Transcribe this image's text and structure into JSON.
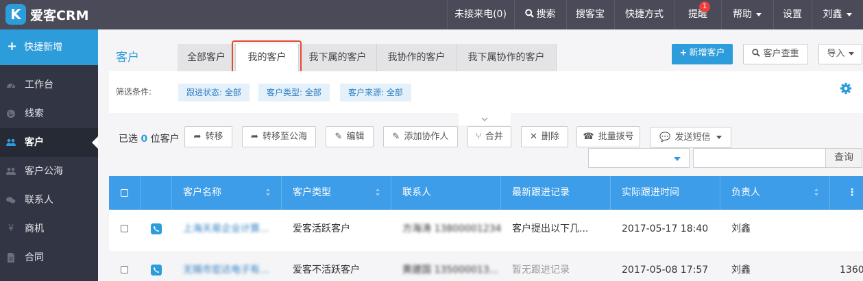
{
  "app": {
    "logo_glyph": "K",
    "name": "爱客CRM",
    "brand_color": "#2d9cdb"
  },
  "topnav": {
    "missed_calls": "未接来电(0)",
    "search": "搜索",
    "search_icon": "search-icon",
    "aike_bao": "搜客宝",
    "shortcuts": "快捷方式",
    "reminders": "提醒",
    "reminders_badge": "1",
    "help": "帮助",
    "settings": "设置",
    "user": "刘鑫"
  },
  "sidebar": {
    "quick_add": "快捷新增",
    "items": [
      {
        "label": "工作台",
        "icon": "dashboard-icon"
      },
      {
        "label": "线索",
        "icon": "globe-icon"
      },
      {
        "label": "客户",
        "icon": "users-icon",
        "active": true
      },
      {
        "label": "客户公海",
        "icon": "users-icon"
      },
      {
        "label": "联系人",
        "icon": "chat-icon"
      },
      {
        "label": "商机",
        "icon": "yen-icon"
      },
      {
        "label": "合同",
        "icon": "document-icon"
      }
    ]
  },
  "page": {
    "title": "客户",
    "tabs": [
      "全部客户",
      "我的客户",
      "我下属的客户",
      "我协作的客户",
      "我下属协作的客户"
    ],
    "active_tab": "我的客户",
    "add_customer": "新增客户",
    "check_duplicate": "客户查重",
    "import": "导入"
  },
  "filters": {
    "label": "筛选条件:",
    "chips": [
      "跟进状态: 全部",
      "客户类型: 全部",
      "客户来源: 全部"
    ]
  },
  "actions": {
    "selected_prefix": "已选",
    "selected_count": "0",
    "selected_suffix": "位客户",
    "buttons": [
      "转移",
      "转移至公海",
      "编辑",
      "添加协作人",
      "合并",
      "删除",
      "批量拨号",
      "发送短信"
    ],
    "query": "查询"
  },
  "table": {
    "columns": [
      "客户名称",
      "客户类型",
      "联系人",
      "最新跟进记录",
      "实际跟进时间",
      "负责人"
    ],
    "rows": [
      {
        "name": "上海天易企业计算...",
        "type": "爱客活跃客户",
        "contact": "方海涛 13800001234...",
        "latest": "客户提出以下几...",
        "time": "2017-05-17 18:40",
        "owner": "刘鑫",
        "phone": ""
      },
      {
        "name": "无锡市宏达电子有...",
        "type": "爱客不活跃客户",
        "contact": "黄建国 135000013...",
        "latest": "暂无跟进记录",
        "time": "2017-05-08 17:57",
        "owner": "刘鑫",
        "phone": "1360"
      }
    ]
  }
}
